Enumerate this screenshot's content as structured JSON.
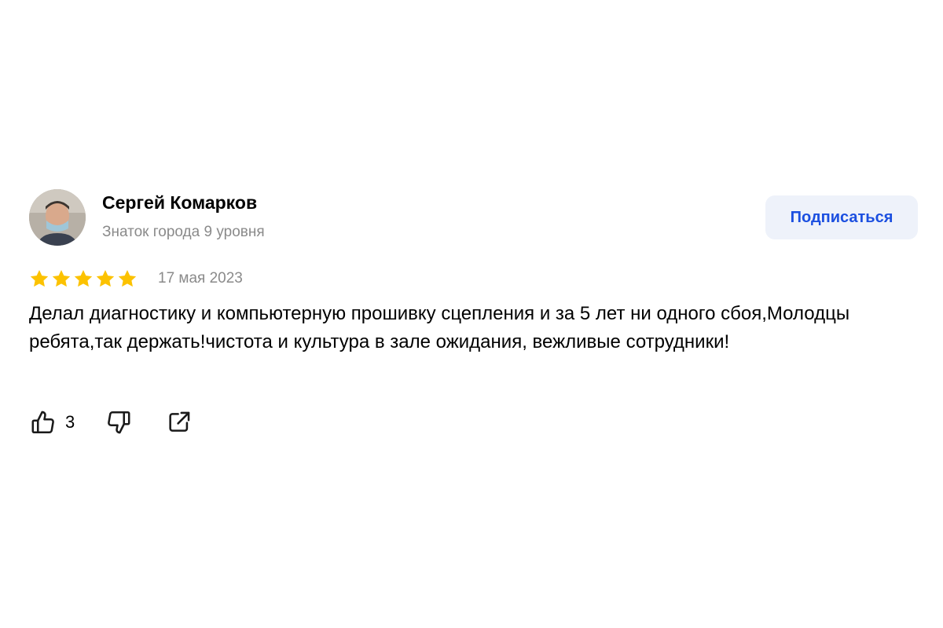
{
  "review": {
    "author": {
      "name": "Сергей Комарков",
      "level": "Знаток города 9 уровня",
      "avatar_icon": "user-photo"
    },
    "subscribe_label": "Подписаться",
    "rating": {
      "value": 5,
      "max": 5,
      "color": "#fcc200"
    },
    "date": "17 мая 2023",
    "text": "Делал диагностику и компьютерную прошивку сцепления и за 5 лет ни одного сбоя,Молодцы ребята,так держать!чистота и культура в зале ожидания, вежливые сотрудники!",
    "actions": {
      "like_icon": "thumbs-up-icon",
      "like_count": "3",
      "dislike_icon": "thumbs-down-icon",
      "share_icon": "share-icon"
    }
  },
  "colors": {
    "accent": "#1b4fe0",
    "button_bg": "#eef2fa",
    "muted_text": "#8a8a8a"
  }
}
